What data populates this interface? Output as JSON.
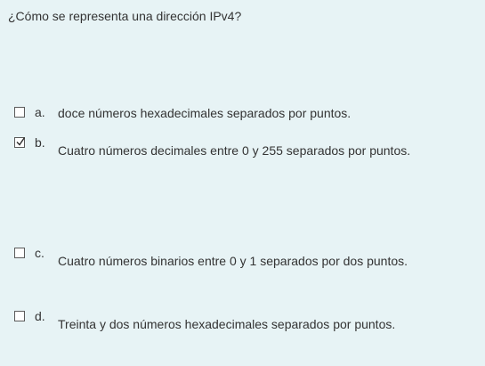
{
  "question": {
    "text": "¿Cómo se representa una dirección IPv4?"
  },
  "options": [
    {
      "letter": "a.",
      "text": "doce números hexadecimales separados por puntos.",
      "checked": false
    },
    {
      "letter": "b.",
      "text": "Cuatro números decimales entre 0 y 255 separados por puntos.",
      "checked": true
    },
    {
      "letter": "c.",
      "text": "Cuatro números binarios entre 0 y 1 separados por dos puntos.",
      "checked": false
    },
    {
      "letter": "d.",
      "text": "Treinta y dos números hexadecimales separados por puntos.",
      "checked": false
    }
  ],
  "colors": {
    "background": "#e7f3f5",
    "text": "#333333",
    "checkbox_border": "#5a5a5a",
    "checkmark": "#2b2b2b"
  }
}
